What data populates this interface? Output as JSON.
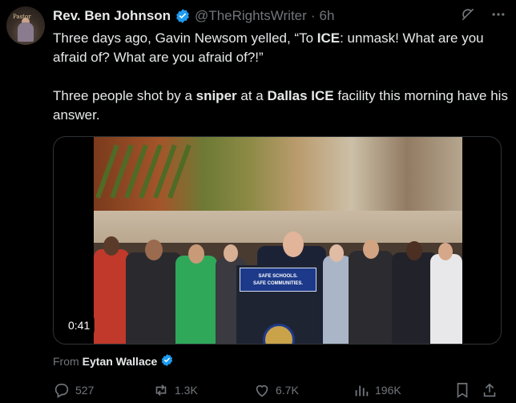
{
  "tweet": {
    "author_name": "Rev. Ben Johnson",
    "author_handle": "@TheRightsWriter",
    "separator": "·",
    "time_ago": "6h",
    "avatar_text": "Pastor",
    "text_line1_pre": "Three days ago, Gavin Newsom yelled, “To ",
    "text_line1_bold": "ICE",
    "text_line1_post": ": unmask! What are you afraid of? What are you afraid of?!”",
    "text_p2_a": "Three people shot by a ",
    "text_p2_b": "sniper",
    "text_p2_c": " at a ",
    "text_p2_d": "Dallas ICE",
    "text_p2_e": " facility this morning have his answer."
  },
  "media": {
    "duration": "0:41",
    "podium_line1": "SAFE SCHOOLS.",
    "podium_line2": "SAFE COMMUNITIES."
  },
  "attribution": {
    "prefix": "From",
    "name": "Eytan Wallace"
  },
  "actions": {
    "replies": "527",
    "reposts": "1.3K",
    "likes": "6.7K",
    "views": "196K"
  },
  "colors": {
    "background": "#000000",
    "verified": "#1d9bf0",
    "muted": "#71767b",
    "text": "#e7e9ea"
  },
  "icons": [
    "grok-icon",
    "more-icon",
    "verified-icon",
    "reply-icon",
    "repost-icon",
    "like-icon",
    "views-icon",
    "bookmark-icon",
    "share-icon"
  ]
}
